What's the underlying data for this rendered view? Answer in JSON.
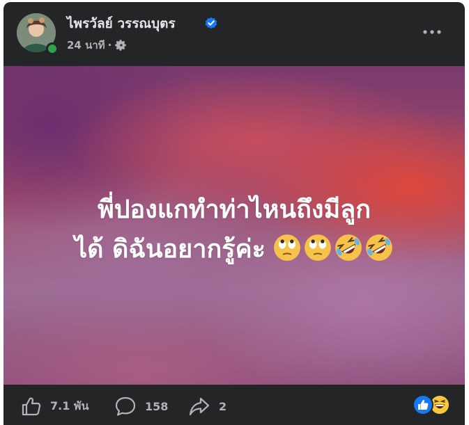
{
  "post": {
    "author_name": "ไพรวัลย์ วรรณบุตร",
    "time": "24 นาที",
    "separator": "·",
    "line1": "พี่ปองแกทำท่าไหนถึงมีลูก",
    "line2": "ได้ ดิฉันอยากรู้ค่ะ",
    "emojis": [
      "face-with-rolling-eyes",
      "face-with-rolling-eyes",
      "rolling-on-floor-laughing",
      "rolling-on-floor-laughing"
    ]
  },
  "actions": {
    "likes": "7.1 พัน",
    "comments": "158",
    "shares": "2"
  },
  "reactions": [
    "like",
    "haha"
  ],
  "colors": {
    "card_bg": "#242526",
    "text_primary": "#e4e6eb",
    "text_secondary": "#b0b3b8",
    "verified": "#1877f2",
    "online": "#31a24c",
    "like_blue": "#1877f2",
    "haha_yellow": "#f7c83d"
  }
}
